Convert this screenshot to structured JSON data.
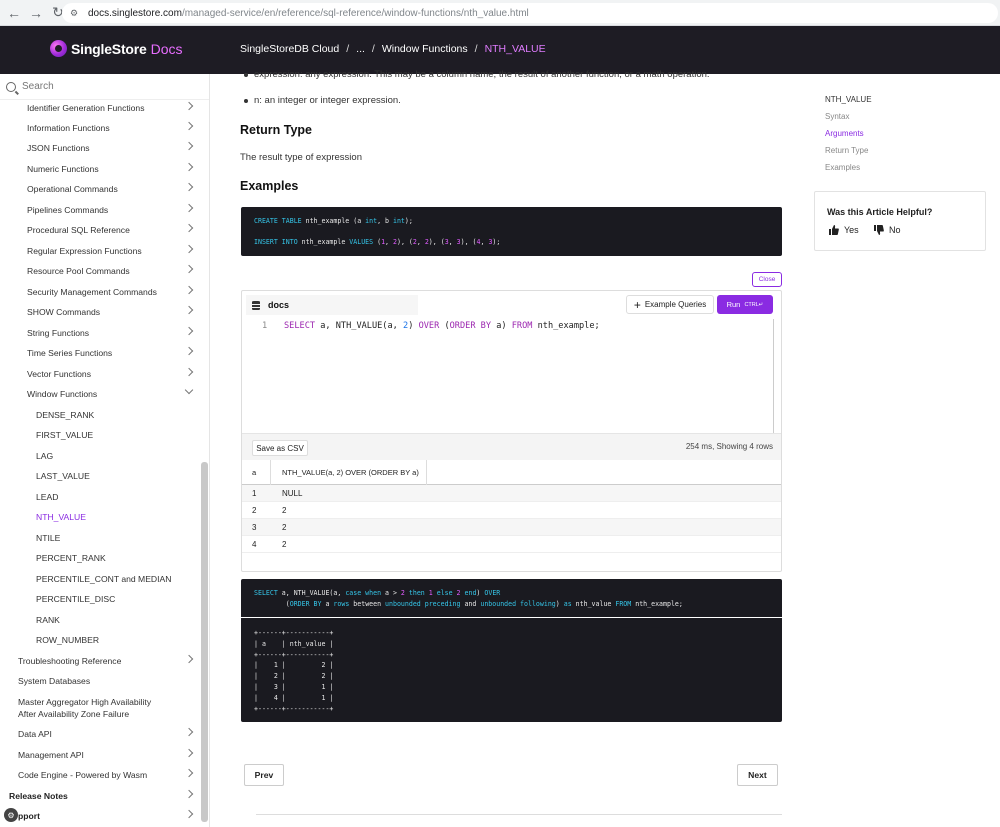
{
  "browser": {
    "url_host": "docs.singlestore.com",
    "url_path": "/managed-service/en/reference/sql-reference/window-functions/nth_value.html"
  },
  "header": {
    "brand": "SingleStore",
    "brand_suffix": "Docs",
    "breadcrumb": [
      "SingleStoreDB Cloud",
      "...",
      "Window Functions",
      "NTH_VALUE"
    ]
  },
  "sidebar": {
    "search_placeholder": "Search",
    "items": [
      {
        "label": "Identifier Generation Functions"
      },
      {
        "label": "Information Functions"
      },
      {
        "label": "JSON Functions"
      },
      {
        "label": "Numeric Functions"
      },
      {
        "label": "Operational Commands"
      },
      {
        "label": "Pipelines Commands"
      },
      {
        "label": "Procedural SQL Reference"
      },
      {
        "label": "Regular Expression Functions"
      },
      {
        "label": "Resource Pool Commands"
      },
      {
        "label": "Security Management Commands"
      },
      {
        "label": "SHOW Commands"
      },
      {
        "label": "String Functions"
      },
      {
        "label": "Time Series Functions"
      },
      {
        "label": "Vector Functions"
      },
      {
        "label": "Window Functions"
      },
      {
        "label": "DENSE_RANK"
      },
      {
        "label": "FIRST_VALUE"
      },
      {
        "label": "LAG"
      },
      {
        "label": "LAST_VALUE"
      },
      {
        "label": "LEAD"
      },
      {
        "label": "NTH_VALUE"
      },
      {
        "label": "NTILE"
      },
      {
        "label": "PERCENT_RANK"
      },
      {
        "label": "PERCENTILE_CONT and MEDIAN"
      },
      {
        "label": "PERCENTILE_DISC"
      },
      {
        "label": "RANK"
      },
      {
        "label": "ROW_NUMBER"
      },
      {
        "label": "Troubleshooting Reference"
      },
      {
        "label": "System Databases"
      },
      {
        "label": "Master Aggregator High Availability"
      },
      {
        "label": "After Availability Zone Failure"
      },
      {
        "label": "Data API"
      },
      {
        "label": "Management API"
      },
      {
        "label": "Code Engine - Powered by Wasm"
      },
      {
        "label": "Release Notes"
      },
      {
        "label": "pport"
      }
    ]
  },
  "content": {
    "bullet_1": "expression: any expression. This may be a column name, the result of another function, or a math operation.",
    "bullet_2": "n: an integer or integer expression.",
    "return_type_heading": "Return Type",
    "return_type_text": "The result type of expression",
    "examples_heading": "Examples",
    "setup_code": {
      "line1": {
        "kw1": "CREATE TABLE",
        "t1": " nth_example (a ",
        "kw2": "int",
        "t2": ", b ",
        "kw3": "int",
        "t3": ");"
      },
      "line2": {
        "kw1": "INSERT INTO",
        "t1": " nth_example ",
        "kw2": "VALUES",
        "t2": " (",
        "n1": "1",
        "t3": ", ",
        "n2": "2",
        "t4": "), (",
        "n3": "2",
        "t5": ", ",
        "n4": "2",
        "t6": "), (",
        "n5": "3",
        "t7": ", ",
        "n6": "3",
        "t8": "), (",
        "n7": "4",
        "t9": ", ",
        "n8": "3",
        "t10": ");"
      }
    },
    "close_label": "Close",
    "editor": {
      "db_name": "docs",
      "example_queries_label": "Example Queries",
      "run_label": "Run",
      "run_shortcut": "CTRL↵",
      "line_number": "1",
      "query": {
        "k1": "SELECT",
        "t1": " a, NTH_VALUE(a, ",
        "n1": "2",
        "t2": ") ",
        "k2": "OVER",
        "t3": " (",
        "k3": "ORDER BY",
        "t4": " a) ",
        "k4": "FROM",
        "t5": " nth_example;"
      },
      "save_csv_label": "Save as CSV",
      "result_meta": "254 ms,  Showing 4 rows",
      "columns": [
        "a",
        "NTH_VALUE(a, 2) OVER (ORDER BY a)"
      ],
      "rows": [
        [
          "1",
          "NULL"
        ],
        [
          "2",
          "2"
        ],
        [
          "3",
          "2"
        ],
        [
          "4",
          "2"
        ]
      ]
    },
    "second_code": {
      "l1": {
        "k1": "SELECT",
        "t1": " a, NTH_VALUE(a, ",
        "k2": "case when",
        "t2": " a > ",
        "n1": "2",
        "k3": " then ",
        "n2": "1",
        "k4": " else ",
        "n3": "2",
        "k5": " end",
        "t3": ") ",
        "k6": "OVER"
      },
      "l2": {
        "indent": "        (",
        "k1": "ORDER BY",
        "t1": " a ",
        "k2": "rows",
        "t2": " between ",
        "k3": "unbounded preceding",
        "t3": " and ",
        "k4": "unbounded following",
        "t4": ") ",
        "k5": "as",
        "t5": " nth_value ",
        "k6": "FROM",
        "t6": " nth_example;"
      }
    },
    "output_text": "+------+-----------+\n| a    | nth_value |\n+------+-----------+\n|    1 |         2 |\n|    2 |         2 |\n|    3 |         1 |\n|    4 |         1 |\n+------+-----------+",
    "prev_label": "Prev",
    "next_label": "Next"
  },
  "toc": {
    "items": [
      "NTH_VALUE",
      "Syntax",
      "Arguments",
      "Return Type",
      "Examples"
    ]
  },
  "helpful": {
    "question": "Was this Article Helpful?",
    "yes": "Yes",
    "no": "No"
  },
  "colors": {
    "accent": "#8a2be2",
    "header_bg": "#1e1c24",
    "code_bg": "#1a1a20"
  }
}
